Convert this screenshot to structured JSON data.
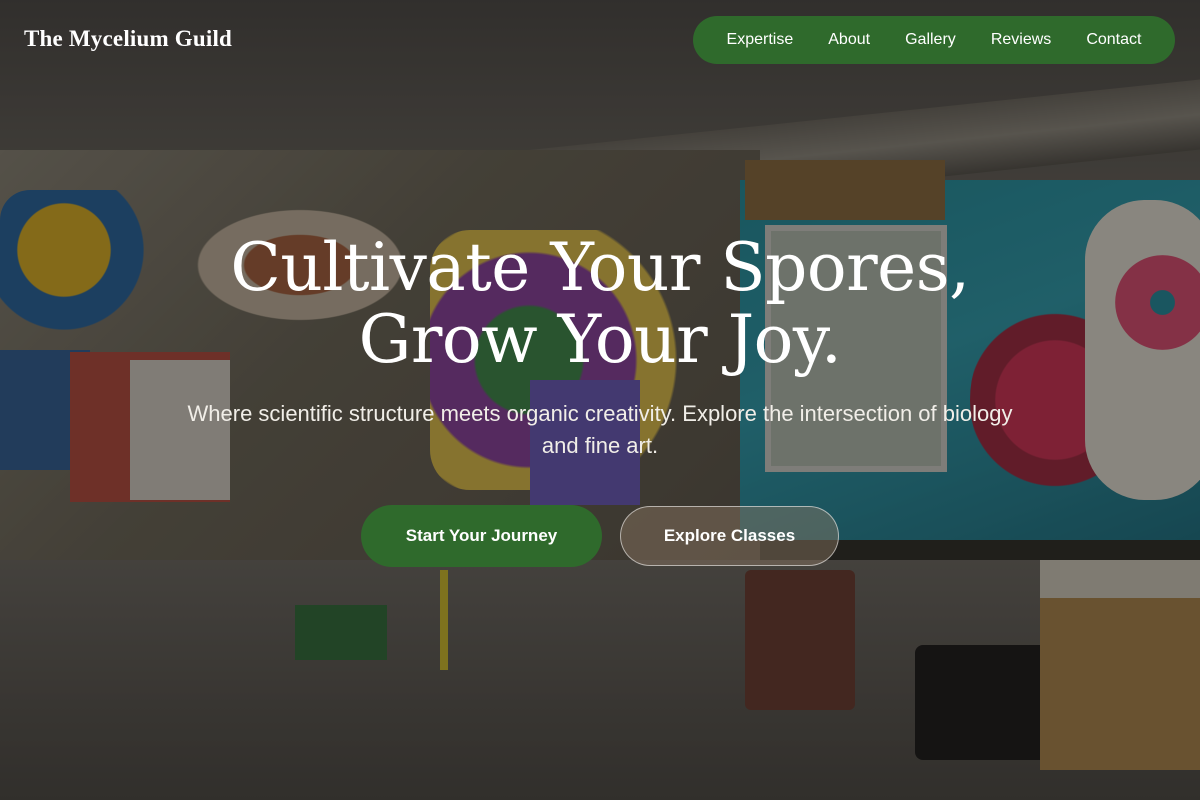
{
  "header": {
    "brand": "The Mycelium Guild",
    "nav": [
      "Expertise",
      "About",
      "Gallery",
      "Reviews",
      "Contact"
    ]
  },
  "hero": {
    "headline_line1": "Cultivate Your Spores,",
    "headline_line2": "Grow Your Joy.",
    "subtitle": "Where scientific structure meets organic creativity. Explore the intersection of biology and fine art.",
    "primary_cta": "Start Your Journey",
    "secondary_cta": "Explore Classes"
  },
  "colors": {
    "accent_green": "#2f6a2c",
    "text_light": "#ffffff"
  }
}
